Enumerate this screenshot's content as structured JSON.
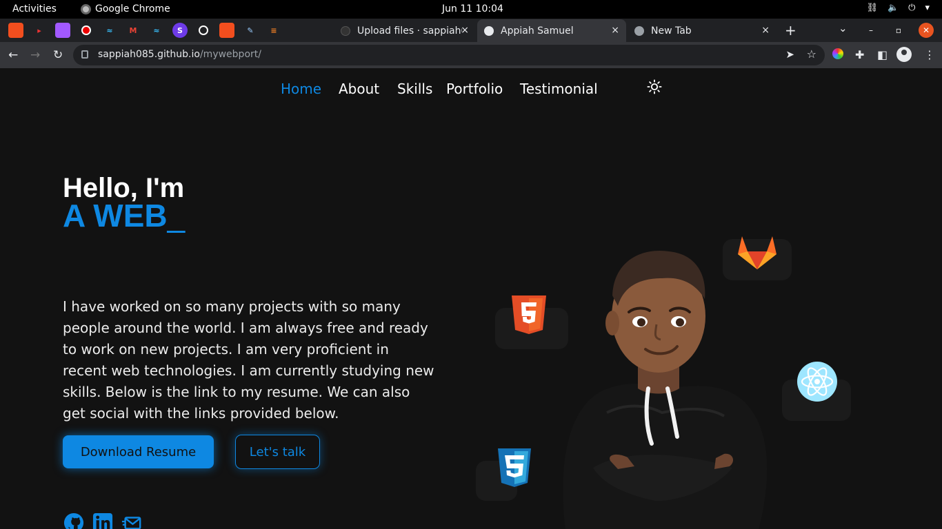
{
  "system_bar": {
    "activities": "Activities",
    "app_name": "Google Chrome",
    "clock": "Jun 11  10:04"
  },
  "browser": {
    "tabs": [
      {
        "title": "Upload files · sappiah0",
        "close": "×"
      },
      {
        "title": "Appiah Samuel",
        "close": "×"
      },
      {
        "title": "New Tab",
        "close": "×"
      }
    ],
    "new_tab": "+",
    "tab_search": "⌄",
    "url_host": "sappiah085.github.io",
    "url_path": "/mywebport/"
  },
  "site": {
    "nav": [
      {
        "label": "Home",
        "active": true
      },
      {
        "label": "About"
      },
      {
        "label": "Skills"
      },
      {
        "label": "Portfolio"
      },
      {
        "label": "Testimonial"
      }
    ],
    "greeting": "Hello, I'm",
    "typed_text": "A WEB",
    "typed_cursor": "_",
    "bio": "I have worked on so many projects with so many people around the world. I am always free and ready to work on new projects. I am very proficient in recent web technologies. I am currently studying new skills. Below is the link to my resume. We can also get social with the links provided below.",
    "primary_button": "Download Resume",
    "secondary_button": "Let's talk",
    "accent_color": "#0e88e2",
    "background_color": "#121212",
    "social_icons": [
      "github-icon",
      "linkedin-icon",
      "email-icon"
    ],
    "tech_icons": [
      "gitlab-icon",
      "html5-icon",
      "react-icon",
      "css3-icon"
    ]
  }
}
